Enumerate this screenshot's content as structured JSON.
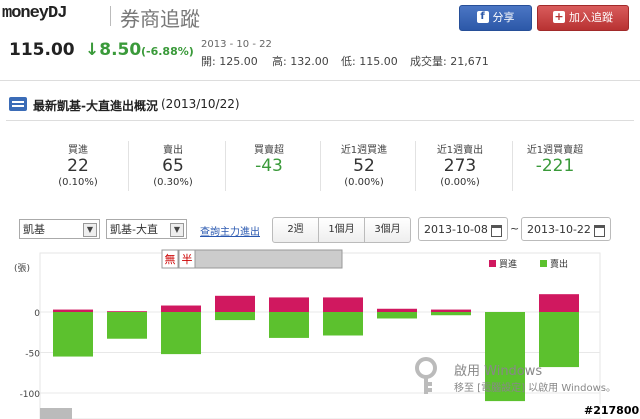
{
  "header": {
    "logo_text": "moneyDJ",
    "page_title": "券商追蹤",
    "share_label": "分享",
    "track_label": "加入追蹤"
  },
  "quote": {
    "price": "115.00",
    "change": "8.50",
    "change_pct": "(-6.88%)",
    "date": "2013 - 10 - 22",
    "open_label": "開:",
    "open": "125.00",
    "high_label": "高:",
    "high": "132.00",
    "low_label": "低:",
    "low": "115.00",
    "volume_label": "成交量:",
    "volume": "21,671"
  },
  "section": {
    "title": "最新凱基-大直進出概況",
    "date": "(2013/10/22)"
  },
  "stats": [
    {
      "label": "買進",
      "value": "22",
      "sub": "(0.10%)",
      "green": false
    },
    {
      "label": "賣出",
      "value": "65",
      "sub": "(0.30%)",
      "green": false
    },
    {
      "label": "買賣超",
      "value": "-43",
      "sub": "",
      "green": true
    },
    {
      "label": "近1週買進",
      "value": "52",
      "sub": "(0.00%)",
      "green": false
    },
    {
      "label": "近1週賣出",
      "value": "273",
      "sub": "(0.00%)",
      "green": false
    },
    {
      "label": "近1週買賣超",
      "value": "-221",
      "sub": "",
      "green": true
    }
  ],
  "controls": {
    "broker": "凱基",
    "branch": "凱基-大直",
    "query_link": "查詢主力進出",
    "ranges": [
      "2週",
      "1個月",
      "3個月"
    ],
    "start_date": "2013-10-08",
    "end_date": "2013-10-22",
    "tilde": "~"
  },
  "chart_data": {
    "type": "bar",
    "unit_label": "(張)",
    "y_ticks": [
      "0",
      "-50",
      "-100"
    ],
    "ylim": [
      -110,
      25
    ],
    "legend": [
      {
        "name": "買進",
        "color": "#d0185f"
      },
      {
        "name": "賣出",
        "color": "#5cc12e"
      }
    ],
    "series": [
      {
        "name": "買進",
        "values": [
          3,
          1,
          8,
          20,
          18,
          18,
          4,
          3,
          0,
          22
        ]
      },
      {
        "name": "賣出",
        "values": [
          -55,
          -33,
          -52,
          -10,
          -32,
          -29,
          -8,
          -4,
          -110,
          -68
        ]
      }
    ],
    "toolbar_buttons": [
      "無",
      "半"
    ]
  },
  "watermark": {
    "line1": "啟用 Windows",
    "line2": "移至 [電腦設定] 以啟用 Windows。"
  },
  "badge": "#217800"
}
